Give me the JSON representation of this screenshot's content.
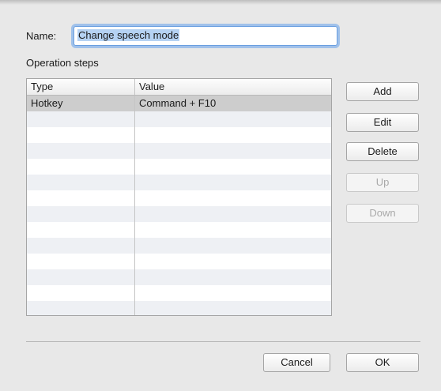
{
  "form": {
    "name_label": "Name:",
    "name_value": "Change speech mode",
    "steps_label": "Operation steps"
  },
  "table": {
    "columns": {
      "type": "Type",
      "value": "Value"
    },
    "rows": [
      {
        "type": "Hotkey",
        "value": "Command + F10"
      },
      {
        "type": "",
        "value": ""
      },
      {
        "type": "",
        "value": ""
      },
      {
        "type": "",
        "value": ""
      },
      {
        "type": "",
        "value": ""
      },
      {
        "type": "",
        "value": ""
      },
      {
        "type": "",
        "value": ""
      },
      {
        "type": "",
        "value": ""
      },
      {
        "type": "",
        "value": ""
      },
      {
        "type": "",
        "value": ""
      },
      {
        "type": "",
        "value": ""
      },
      {
        "type": "",
        "value": ""
      },
      {
        "type": "",
        "value": ""
      },
      {
        "type": "",
        "value": ""
      }
    ]
  },
  "buttons": {
    "add": "Add",
    "edit": "Edit",
    "delete": "Delete",
    "up": "Up",
    "down": "Down",
    "cancel": "Cancel",
    "ok": "OK"
  }
}
